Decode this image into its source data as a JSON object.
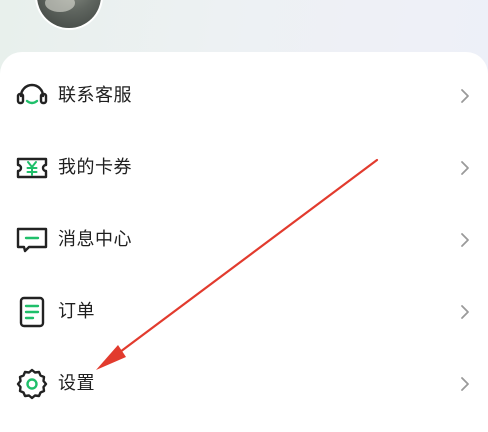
{
  "colors": {
    "accent": "#1fbf6a",
    "icon_stroke": "#222222",
    "text": "#1f1f1f",
    "chevron": "#9a9a9a",
    "annotation_arrow": "#e23b2e"
  },
  "menu": {
    "items": [
      {
        "label": "联系客服",
        "icon": "headset-icon"
      },
      {
        "label": "我的卡券",
        "icon": "coupon-icon"
      },
      {
        "label": "消息中心",
        "icon": "message-icon"
      },
      {
        "label": "订单",
        "icon": "order-icon"
      },
      {
        "label": "设置",
        "icon": "gear-icon"
      }
    ]
  }
}
